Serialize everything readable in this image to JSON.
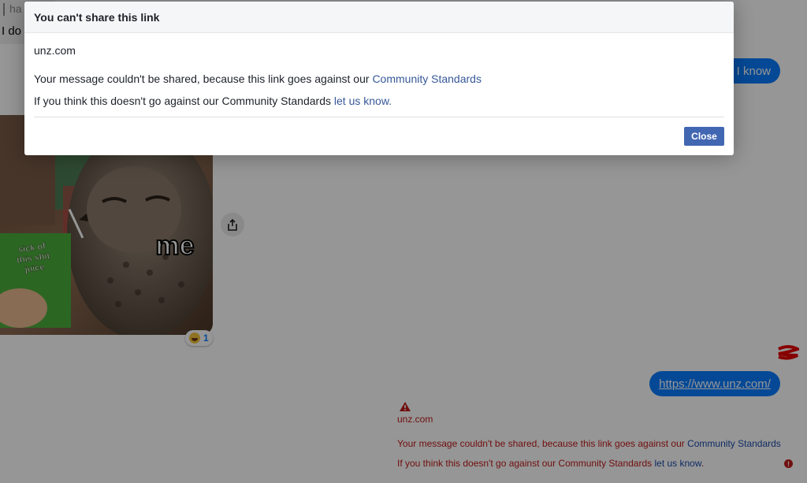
{
  "conversation": {
    "quoted_snippet": "ha",
    "received_snippet": "I do",
    "sent_message_1": "I know",
    "meme": {
      "caption": "me",
      "juice_label": "sick of this shit juice"
    },
    "reaction": {
      "count": "1"
    },
    "sent_link": "https://www.unz.com/",
    "error": {
      "domain": "unz.com",
      "message_prefix": "Your message couldn't be shared, because this link goes against our",
      "message_link": "Community Standards",
      "hint_prefix": "If you think this doesn't go against our Community Standards",
      "hint_link": "let us know",
      "hint_suffix": "."
    }
  },
  "dialog": {
    "title": "You can't share this link",
    "domain": "unz.com",
    "message_prefix": "Your message couldn't be shared, because this link goes against our",
    "message_link": "Community Standards",
    "hint_prefix": "If you think this doesn't go against our Community Standards",
    "hint_link": "let us know",
    "hint_suffix": ".",
    "close_label": "Close"
  },
  "colors": {
    "messenger_blue": "#0a7cff",
    "facebook_button": "#4267b2",
    "link_blue": "#365899",
    "error_red": "#c01a1a"
  },
  "icons": [
    "share-icon",
    "warning-icon",
    "error-icon",
    "laughing-emoji-icon"
  ]
}
